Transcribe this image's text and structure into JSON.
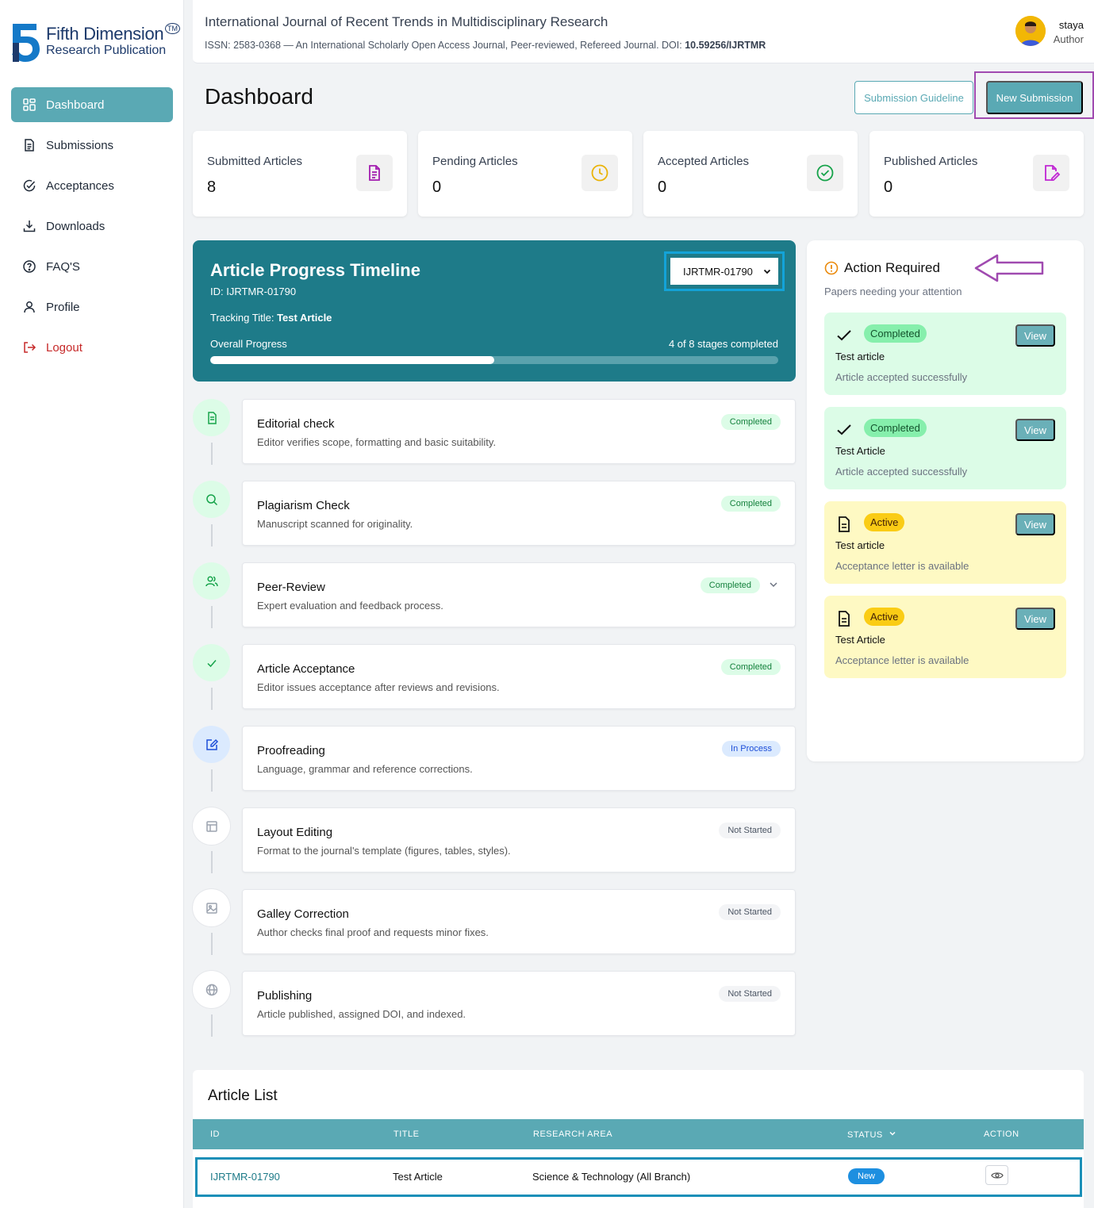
{
  "brand": {
    "line1": "Fifth Dimension",
    "line2": "Research Publication",
    "tm": "TM"
  },
  "sidebar": {
    "items": [
      {
        "label": "Dashboard",
        "icon": "dashboard-grid-icon"
      },
      {
        "label": "Submissions",
        "icon": "document-icon"
      },
      {
        "label": "Acceptances",
        "icon": "check-circle-icon"
      },
      {
        "label": "Downloads",
        "icon": "download-icon"
      },
      {
        "label": "FAQ'S",
        "icon": "help-circle-icon"
      },
      {
        "label": "Profile",
        "icon": "user-icon"
      },
      {
        "label": "Logout",
        "icon": "logout-icon"
      }
    ]
  },
  "header": {
    "title": "International Journal of Recent Trends in Multidisciplinary Research",
    "subtitle_prefix": "ISSN: 2583-0368 — An International Scholarly Open Access Journal, Peer-reviewed, Refereed Journal. DOI:",
    "doi": "10.59256/IJRTMR",
    "user_name": "staya",
    "user_role": "Author"
  },
  "page": {
    "title": "Dashboard",
    "guideline_btn": "Submission Guideline",
    "new_btn": "New Submission"
  },
  "stats": [
    {
      "label": "Submitted Articles",
      "value": "8",
      "icon": "document-icon",
      "color": "#a21caf"
    },
    {
      "label": "Pending Articles",
      "value": "0",
      "icon": "clock-icon",
      "color": "#eab308"
    },
    {
      "label": "Accepted Articles",
      "value": "0",
      "icon": "check-circle-icon",
      "color": "#16a34a"
    },
    {
      "label": "Published Articles",
      "value": "0",
      "icon": "edit-document-icon",
      "color": "#c026d3"
    }
  ],
  "timeline": {
    "title": "Article Progress Timeline",
    "id_text": "ID: IJRTMR-01790",
    "track_label": "Tracking Title:",
    "track_value": "Test Article",
    "overall_label": "Overall Progress",
    "stages_text": "4 of 8 stages completed",
    "progress": 0.5,
    "selected": "IJRTMR-01790"
  },
  "stages": [
    {
      "name": "Editorial check",
      "desc": "Editor verifies scope, formatting and basic suitability.",
      "status": "Completed",
      "kind": "done",
      "icon": "document-icon"
    },
    {
      "name": "Plagiarism Check",
      "desc": "Manuscript scanned for originality.",
      "status": "Completed",
      "kind": "done",
      "icon": "search-icon"
    },
    {
      "name": "Peer-Review",
      "desc": "Expert evaluation and feedback process.",
      "status": "Completed",
      "kind": "done",
      "icon": "users-icon"
    },
    {
      "name": "Article Acceptance",
      "desc": "Editor issues acceptance after reviews and revisions.",
      "status": "Completed",
      "kind": "done",
      "icon": "check-icon"
    },
    {
      "name": "Proofreading",
      "desc": "Language, grammar and reference corrections.",
      "status": "In Process",
      "kind": "proc",
      "icon": "edit-icon"
    },
    {
      "name": "Layout Editing",
      "desc": "Format to the journal's template (figures, tables, styles).",
      "status": "Not Started",
      "kind": "not",
      "icon": "layout-icon"
    },
    {
      "name": "Galley Correction",
      "desc": "Author checks final proof and requests minor fixes.",
      "status": "Not Started",
      "kind": "not",
      "icon": "image-icon"
    },
    {
      "name": "Publishing",
      "desc": "Article published, assigned DOI, and indexed.",
      "status": "Not Started",
      "kind": "not",
      "icon": "globe-icon"
    }
  ],
  "action": {
    "title": "Action Required",
    "subtitle": "Papers needing your attention",
    "items": [
      {
        "badge": "Completed",
        "name": "Test article",
        "desc": "Article accepted successfully",
        "view": "View",
        "kind": "green"
      },
      {
        "badge": "Completed",
        "name": "Test Article",
        "desc": "Article accepted successfully",
        "view": "View",
        "kind": "green"
      },
      {
        "badge": "Active",
        "name": "Test article",
        "desc": "Acceptance letter is available",
        "view": "View",
        "kind": "yellow"
      },
      {
        "badge": "Active",
        "name": "Test Article",
        "desc": "Acceptance letter is available",
        "view": "View",
        "kind": "yellow"
      }
    ]
  },
  "article_list": {
    "title": "Article List",
    "columns": [
      "ID",
      "TITLE",
      "RESEARCH AREA",
      "STATUS",
      "ACTION"
    ],
    "rows": [
      {
        "id": "IJRTMR-01790",
        "title": "Test Article",
        "area": "Science & Technology (All Branch)",
        "status": "New"
      }
    ]
  }
}
